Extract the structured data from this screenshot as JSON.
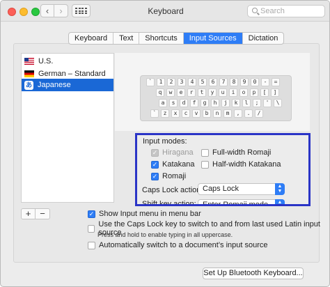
{
  "window": {
    "title": "Keyboard"
  },
  "search": {
    "placeholder": "Search"
  },
  "tabs": [
    {
      "label": "Keyboard"
    },
    {
      "label": "Text"
    },
    {
      "label": "Shortcuts"
    },
    {
      "label": "Input Sources",
      "active": true
    },
    {
      "label": "Dictation"
    }
  ],
  "sources": [
    {
      "label": "U.S.",
      "flag": "us-flag-icon"
    },
    {
      "label": "German – Standard",
      "flag": "de-flag-icon"
    },
    {
      "label": "Japanese",
      "flag": "japanese-input-icon",
      "selected": true
    }
  ],
  "sources_buttons": {
    "add": "+",
    "remove": "−"
  },
  "keyboard": {
    "rows": [
      [
        "`",
        "1",
        "2",
        "3",
        "4",
        "5",
        "6",
        "7",
        "8",
        "9",
        "0",
        "-",
        "="
      ],
      [
        "q",
        "w",
        "e",
        "r",
        "t",
        "y",
        "u",
        "i",
        "o",
        "p",
        "[",
        "]"
      ],
      [
        "a",
        "s",
        "d",
        "f",
        "g",
        "h",
        "j",
        "k",
        "l",
        ";",
        "'",
        "\\"
      ],
      [
        "`",
        "z",
        "x",
        "c",
        "v",
        "b",
        "n",
        "m",
        ",",
        ".",
        "/"
      ]
    ]
  },
  "input_modes": {
    "label": "Input modes:",
    "hiragana": {
      "label": "Hiragana",
      "checked": true,
      "disabled": true
    },
    "katakana": {
      "label": "Katakana",
      "checked": true
    },
    "romaji": {
      "label": "Romaji",
      "checked": true
    },
    "fw_romaji": {
      "label": "Full-width Romaji",
      "checked": false
    },
    "hw_katakana": {
      "label": "Half-width Katakana",
      "checked": false
    },
    "caps_label": "Caps Lock action:",
    "caps_value": "Caps Lock",
    "shift_label": "Shift key action:",
    "shift_value": "Enter Romaji mode"
  },
  "options": {
    "show_menu": {
      "label": "Show Input menu in menu bar",
      "checked": true
    },
    "caps_switch": {
      "label": "Use the Caps Lock key to switch to and from last used Latin input source",
      "checked": false
    },
    "caps_note": "Press and hold to enable typing in all uppercase.",
    "auto_switch": {
      "label": "Automatically switch to a document’s input source",
      "checked": false
    }
  },
  "bluetooth_button": "Set Up Bluetooth Keyboard...",
  "colors": {
    "accent": "#2e7df6",
    "selection": "#1a68d6",
    "highlight_border": "#2a34c6"
  }
}
